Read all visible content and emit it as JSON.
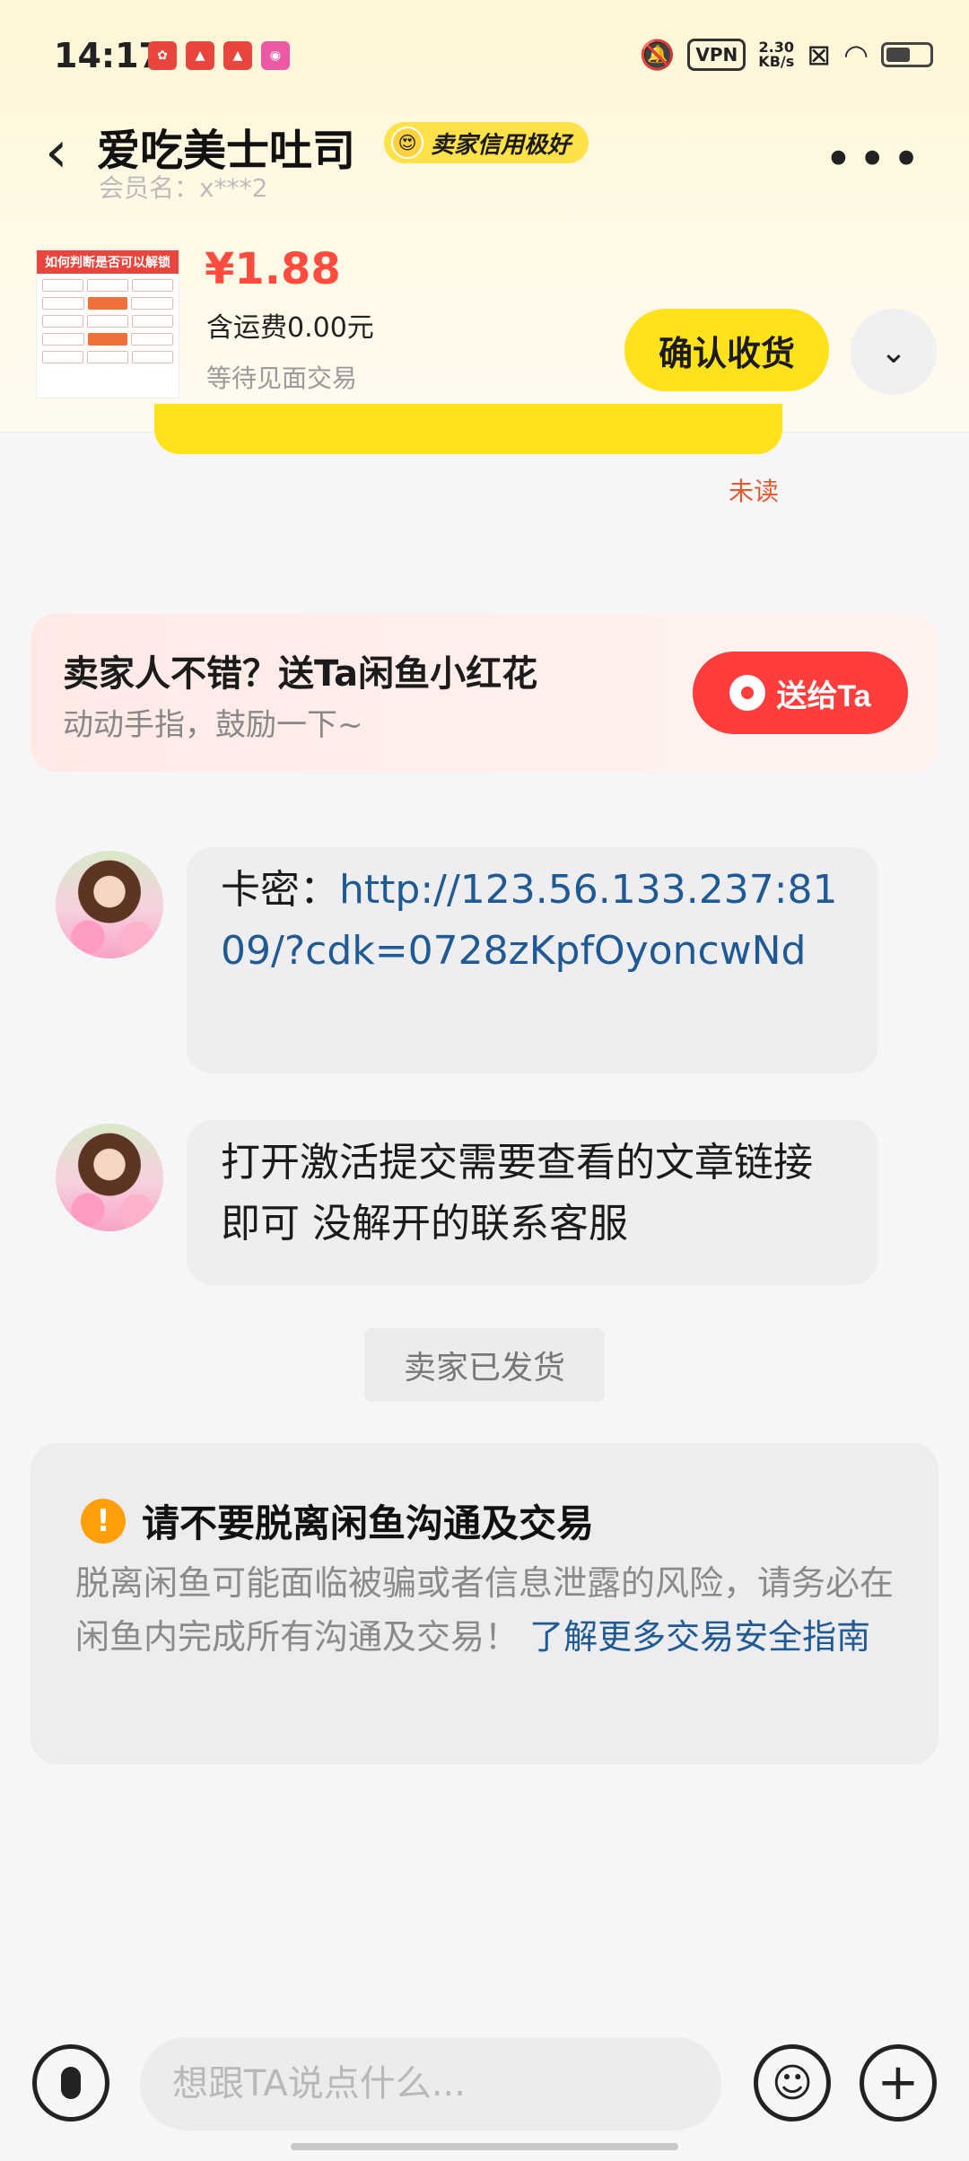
{
  "status_bar": {
    "time": "14:17",
    "speed_value": "2.30",
    "speed_unit": "KB/s",
    "vpn": "VPN"
  },
  "header": {
    "seller_name": "爱吃美士吐司",
    "credit_badge": "卖家信用极好",
    "member": "会员名：x***2"
  },
  "product": {
    "thumbnail_title": "如何判断是否可以解锁",
    "price": "¥1.88",
    "shipping": "含运费0.00元",
    "status": "等待见面交易",
    "confirm_button": "确认收货"
  },
  "chat": {
    "unread_label": "未读",
    "flower_card": {
      "title": "卖家人不错？送Ta闲鱼小红花",
      "subtitle": "动动手指，鼓励一下~",
      "button": "送给Ta"
    },
    "messages": [
      {
        "prefix": "卡密：",
        "link": "http://123.56.133.237:8109/?cdk=0728zKpfOyoncwNd"
      },
      {
        "text": "打开激活提交需要查看的文章链接即可 没解开的联系客服"
      }
    ],
    "system_tag": "卖家已发货",
    "safety": {
      "title": "请不要脱离闲鱼沟通及交易",
      "body": "脱离闲鱼可能面临被骗或者信息泄露的风险，请务必在闲鱼内完成所有沟通及交易！",
      "link": "了解更多交易安全指南"
    }
  },
  "input_bar": {
    "placeholder": "想跟TA说点什么..."
  }
}
